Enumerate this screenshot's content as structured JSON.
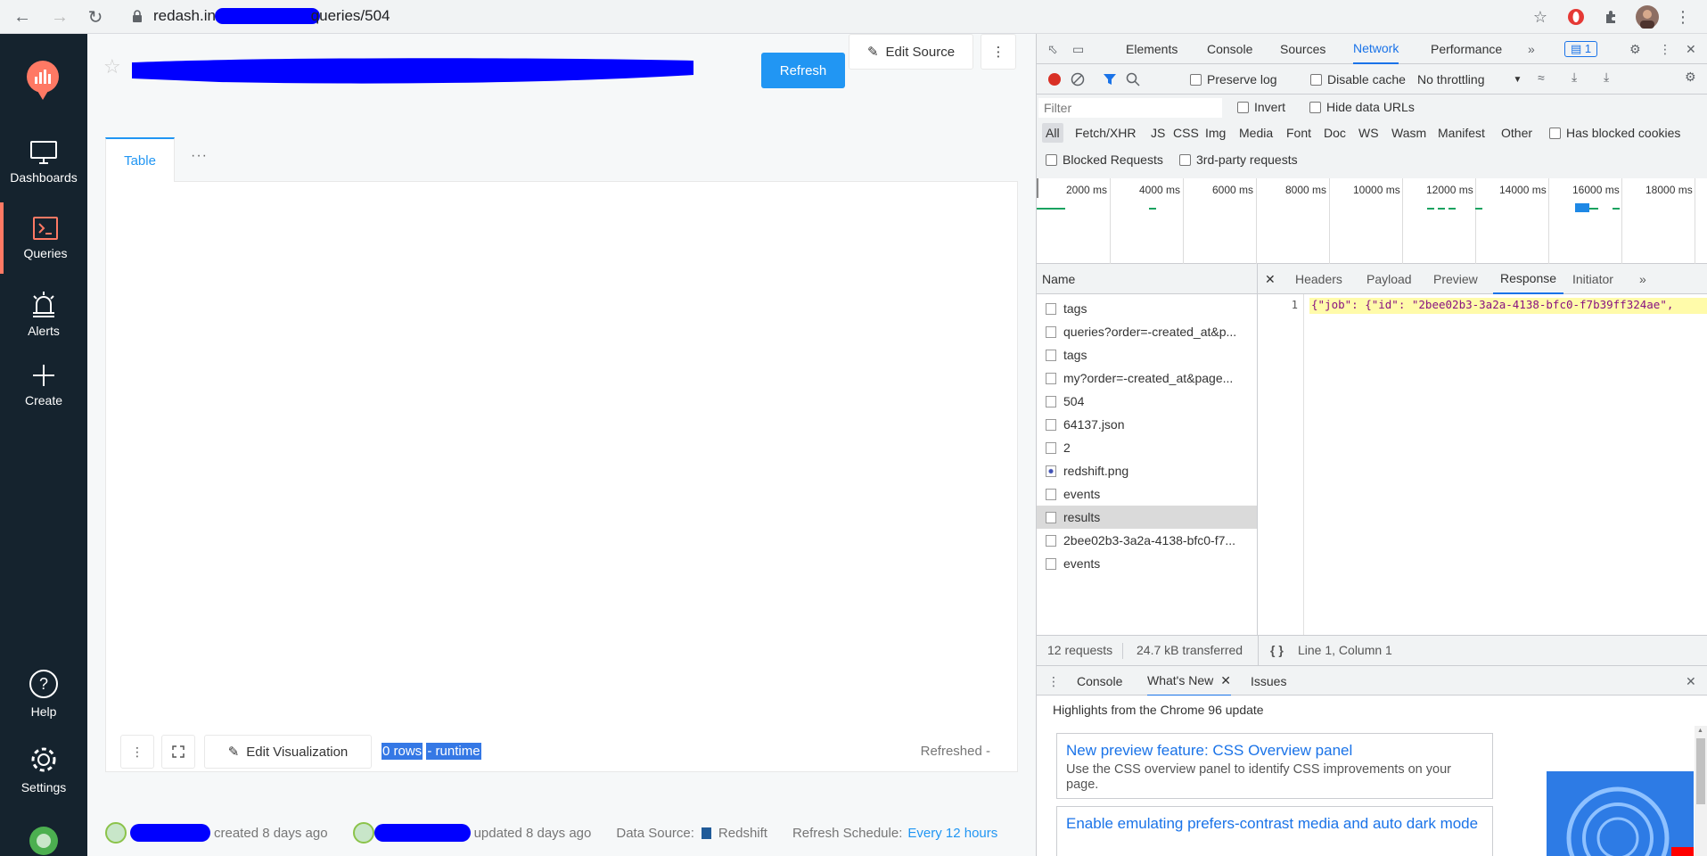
{
  "browser": {
    "url_prefix": "redash.int",
    "url_suffix": "queries/504"
  },
  "sidebar": {
    "items": [
      {
        "label": "Dashboards"
      },
      {
        "label": "Queries"
      },
      {
        "label": "Alerts"
      },
      {
        "label": "Create"
      },
      {
        "label": "Help"
      },
      {
        "label": "Settings"
      }
    ]
  },
  "query": {
    "refresh_label": "Refresh",
    "edit_source_label": "Edit Source",
    "tab_table": "Table",
    "tab_more": "···",
    "edit_viz_label": "Edit Visualization",
    "rows_label": "0 rows",
    "runtime_label": "- runtime",
    "refreshed_label": "Refreshed -",
    "created_label": "created 8 days ago",
    "updated_label": "updated 8 days ago",
    "data_source_label": "Data Source:",
    "data_source_value": "Redshift",
    "refresh_schedule_label": "Refresh Schedule:",
    "refresh_schedule_value": "Every 12 hours"
  },
  "devtools": {
    "tabs": [
      "Elements",
      "Console",
      "Sources",
      "Network",
      "Performance"
    ],
    "issues_count": "1",
    "preserve_log": "Preserve log",
    "disable_cache": "Disable cache",
    "throttling": "No throttling",
    "filter_placeholder": "Filter",
    "invert": "Invert",
    "hide_data_urls": "Hide data URLs",
    "type_filters": [
      "All",
      "Fetch/XHR",
      "JS",
      "CSS",
      "Img",
      "Media",
      "Font",
      "Doc",
      "WS",
      "Wasm",
      "Manifest",
      "Other"
    ],
    "has_blocked_cookies": "Has blocked cookies",
    "blocked_requests": "Blocked Requests",
    "third_party": "3rd-party requests",
    "timeline_ticks": [
      "2000 ms",
      "4000 ms",
      "6000 ms",
      "8000 ms",
      "10000 ms",
      "12000 ms",
      "14000 ms",
      "16000 ms",
      "18000 ms"
    ],
    "name_header": "Name",
    "requests": [
      "tags",
      "queries?order=-created_at&p...",
      "tags",
      "my?order=-created_at&page...",
      "504",
      "64137.json",
      "2",
      "redshift.png",
      "events",
      "results",
      "2bee02b3-3a2a-4138-bfc0-f7...",
      "events"
    ],
    "detail_tabs": [
      "Headers",
      "Payload",
      "Preview",
      "Response",
      "Initiator"
    ],
    "line_number": "1",
    "response_text": "{\"job\": {\"id\": \"2bee02b3-3a2a-4138-bfc0-f7b39ff324ae\",",
    "requests_count": "12 requests",
    "transferred": "24.7 kB transferred",
    "cursor_pos": "Line 1, Column 1",
    "drawer_tabs": [
      "Console",
      "What's New",
      "Issues"
    ],
    "whats_new_heading": "Highlights from the Chrome 96 update",
    "cards": [
      {
        "title": "New preview feature: CSS Overview panel",
        "desc": "Use the CSS overview panel to identify CSS improvements on your page."
      },
      {
        "title": "Enable emulating prefers-contrast media and auto dark mode",
        "desc": ""
      }
    ]
  },
  "colors": {
    "sidebar_bg": "#15232e",
    "accent": "#2196f3",
    "active_marker": "#ff7964",
    "selection": "#3578e5"
  }
}
